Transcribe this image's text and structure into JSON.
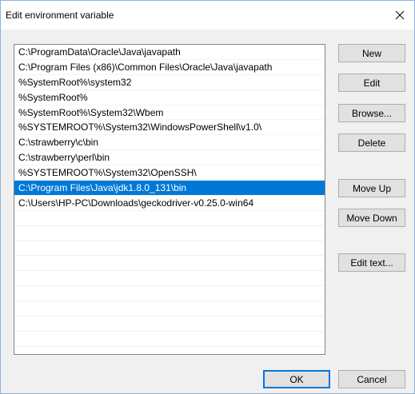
{
  "window": {
    "title": "Edit environment variable",
    "close_icon": "close-icon"
  },
  "list": {
    "items": [
      {
        "label": "C:\\ProgramData\\Oracle\\Java\\javapath",
        "selected": false
      },
      {
        "label": "C:\\Program Files (x86)\\Common Files\\Oracle\\Java\\javapath",
        "selected": false
      },
      {
        "label": "%SystemRoot%\\system32",
        "selected": false
      },
      {
        "label": "%SystemRoot%",
        "selected": false
      },
      {
        "label": "%SystemRoot%\\System32\\Wbem",
        "selected": false
      },
      {
        "label": "%SYSTEMROOT%\\System32\\WindowsPowerShell\\v1.0\\",
        "selected": false
      },
      {
        "label": "C:\\strawberry\\c\\bin",
        "selected": false
      },
      {
        "label": "C:\\strawberry\\perl\\bin",
        "selected": false
      },
      {
        "label": "%SYSTEMROOT%\\System32\\OpenSSH\\",
        "selected": false
      },
      {
        "label": "C:\\Program Files\\Java\\jdk1.8.0_131\\bin",
        "selected": true
      },
      {
        "label": "C:\\Users\\HP-PC\\Downloads\\geckodriver-v0.25.0-win64",
        "selected": false
      }
    ],
    "selection_color": "#0078d7"
  },
  "buttons": {
    "new": "New",
    "edit": "Edit",
    "browse": "Browse...",
    "delete": "Delete",
    "move_up": "Move Up",
    "move_down": "Move Down",
    "edit_text": "Edit text...",
    "ok": "OK",
    "cancel": "Cancel"
  }
}
